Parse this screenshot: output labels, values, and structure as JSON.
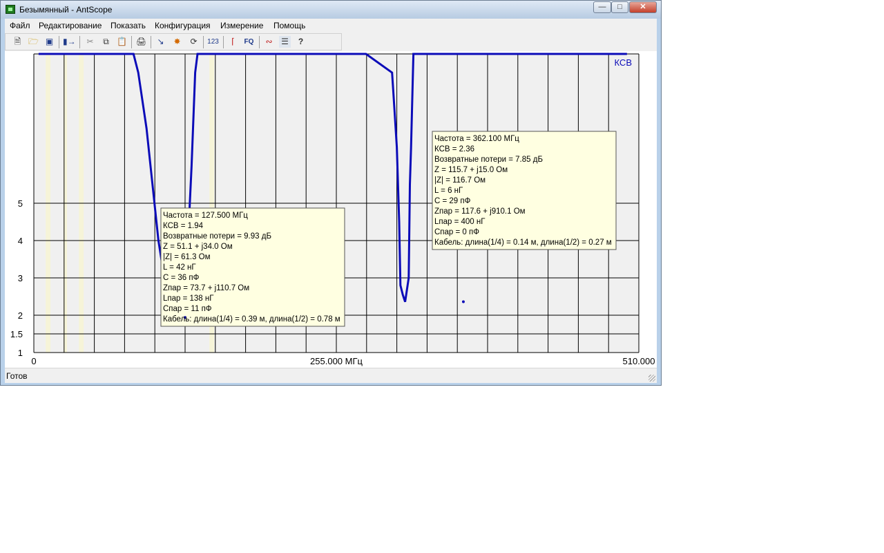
{
  "window": {
    "title": "Безымянный - AntScope",
    "minimize": "—",
    "maximize": "□",
    "close": "✕"
  },
  "menu": [
    "Файл",
    "Редактирование",
    "Показать",
    "Конфигурация",
    "Измерение",
    "Помощь"
  ],
  "toolbar": {
    "icons": [
      "new-file-icon",
      "open-folder-icon",
      "save-icon",
      "export-icon",
      "cut-icon",
      "copy-icon",
      "paste-icon",
      "print-icon",
      "chart-icon",
      "scan-icon",
      "refresh-icon",
      "numeric-icon",
      "antenna-icon",
      "frequency-icon",
      "markers-icon",
      "notes-icon",
      "help-icon"
    ],
    "numeric_label": "123",
    "fq_label": "FQ",
    "help_label": "?"
  },
  "chart_data": {
    "type": "line",
    "title": "",
    "series": [
      {
        "name": "КСВ",
        "color": "#0b0bb8",
        "x": [
          4,
          84,
          88,
          95,
          100,
          105,
          110,
          115,
          122,
          123,
          126,
          130,
          133,
          136,
          138,
          145,
          200,
          280,
          302,
          304,
          306,
          308,
          309,
          311,
          313,
          316,
          317,
          318,
          320,
          325,
          500
        ],
        "y": [
          9,
          9,
          8.5,
          7,
          5.5,
          4,
          3,
          2.2,
          1.94,
          2.0,
          3.0,
          4.0,
          6.0,
          8.5,
          9,
          9,
          9,
          9,
          8.5,
          7.5,
          6.5,
          4.5,
          2.8,
          2.55,
          2.36,
          3,
          5.5,
          6.5,
          9,
          9,
          9
        ]
      }
    ],
    "xlim": [
      0,
      510
    ],
    "ylim": [
      1,
      9
    ],
    "x_tick_labels": [
      "0",
      "255.000 МГц",
      "510.000"
    ],
    "y_ticks": [
      1,
      1.5,
      2,
      3,
      4,
      5
    ],
    "grid": true,
    "legend": "top-right",
    "markers": [
      {
        "x": 127.5,
        "y": 1.94,
        "lines": [
          "Частота = 127.500 МГц",
          "КСВ = 1.94",
          "Возвратные потери = 9.93 дБ",
          "Z = 51.1 + j34.0 Ом",
          "|Z| = 61.3 Ом",
          "L = 42 нГ",
          "C = 36 пФ",
          "Zпар = 73.7 + j110.7 Ом",
          "Lпар = 138 нГ",
          "Cпар = 11 пФ",
          "Кабель: длина(1/4) = 0.39 м, длина(1/2) = 0.78 м"
        ]
      },
      {
        "x": 362.1,
        "y": 2.36,
        "lines": [
          "Частота = 362.100 МГц",
          "КСВ = 2.36",
          "Возвратные потери = 7.85 дБ",
          "Z = 115.7 + j15.0 Ом",
          "|Z| = 116.7 Ом",
          "L = 6 нГ",
          "C = 29 пФ",
          "Zпар = 117.6 + j910.1 Ом",
          "Lпар = 400 нГ",
          "Cпар = 0 пФ",
          "Кабель: длина(1/4) = 0.14 м, длина(1/2) = 0.27 м"
        ]
      }
    ]
  },
  "status": {
    "text": "Готов"
  }
}
